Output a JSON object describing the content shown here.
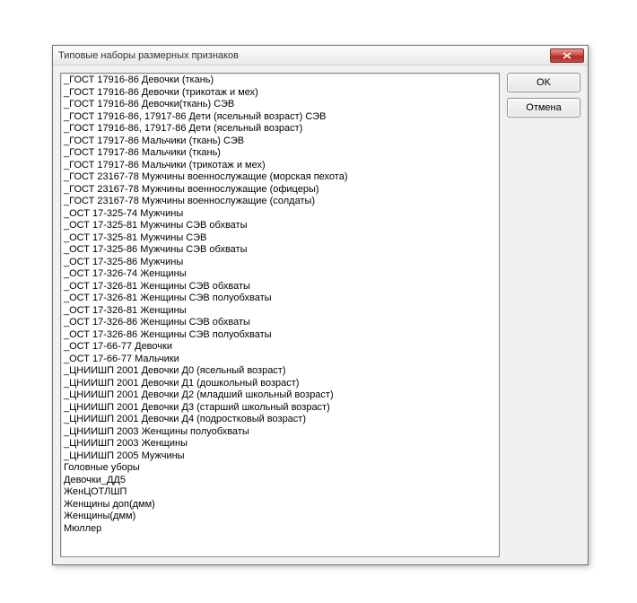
{
  "dialog": {
    "title": "Типовые наборы размерных признаков",
    "buttons": {
      "ok": "OK",
      "cancel": "Отмена"
    },
    "list": {
      "items": [
        "_ГОСТ 17916-86  Девочки (ткань)",
        "_ГОСТ 17916-86  Девочки (трикотаж и мех)",
        "_ГОСТ 17916-86  Девочки(ткань)  СЭВ",
        "_ГОСТ 17916-86,  17917-86  Дети (ясельный возраст) СЭВ",
        "_ГОСТ 17916-86,  17917-86  Дети (ясельный возраст)",
        "_ГОСТ 17917-86  Мальчики (ткань) СЭВ",
        "_ГОСТ 17917-86  Мальчики (ткань)",
        "_ГОСТ 17917-86  Мальчики (трикотаж и мех)",
        "_ГОСТ 23167-78  Мужчины военнослужащие (морская пехота)",
        "_ГОСТ 23167-78  Мужчины военнослужащие (офицеры)",
        "_ГОСТ 23167-78  Мужчины военнослужащие (солдаты)",
        "_ОСТ 17-325-74 Мужчины",
        "_ОСТ 17-325-81 Мужчины СЭВ обхваты",
        "_ОСТ 17-325-81 Мужчины СЭВ",
        "_ОСТ 17-325-86 Мужчины СЭВ обхваты",
        "_ОСТ 17-325-86 Мужчины",
        "_ОСТ 17-326-74 Женщины",
        "_ОСТ 17-326-81 Женщины СЭВ обхваты",
        "_ОСТ 17-326-81 Женщины СЭВ полуобхваты",
        "_ОСТ 17-326-81 Женщины",
        "_ОСТ 17-326-86 Женщины СЭВ обхваты",
        "_ОСТ 17-326-86 Женщины СЭВ полуобхваты",
        "_ОСТ 17-66-77 Девочки",
        "_ОСТ 17-66-77 Мальчики",
        "_ЦНИИШП 2001  Девочки Д0 (ясельный возраст)",
        "_ЦНИИШП 2001  Девочки Д1 (дошкольный возраст)",
        "_ЦНИИШП 2001  Девочки Д2 (младший школьный возраст)",
        "_ЦНИИШП 2001  Девочки Д3 (старший школьный возраст)",
        "_ЦНИИШП 2001  Девочки Д4 (подростковый возраст)",
        "_ЦНИИШП 2003  Женщины полуобхваты",
        "_ЦНИИШП 2003  Женщины",
        "_ЦНИИШП 2005  Мужчины",
        "Головные уборы",
        "Девочки_ДД5",
        "ЖенЦОТЛШП",
        "Женщины доп(дмм)",
        "Женщины(дмм)",
        "Мюллер"
      ]
    }
  }
}
